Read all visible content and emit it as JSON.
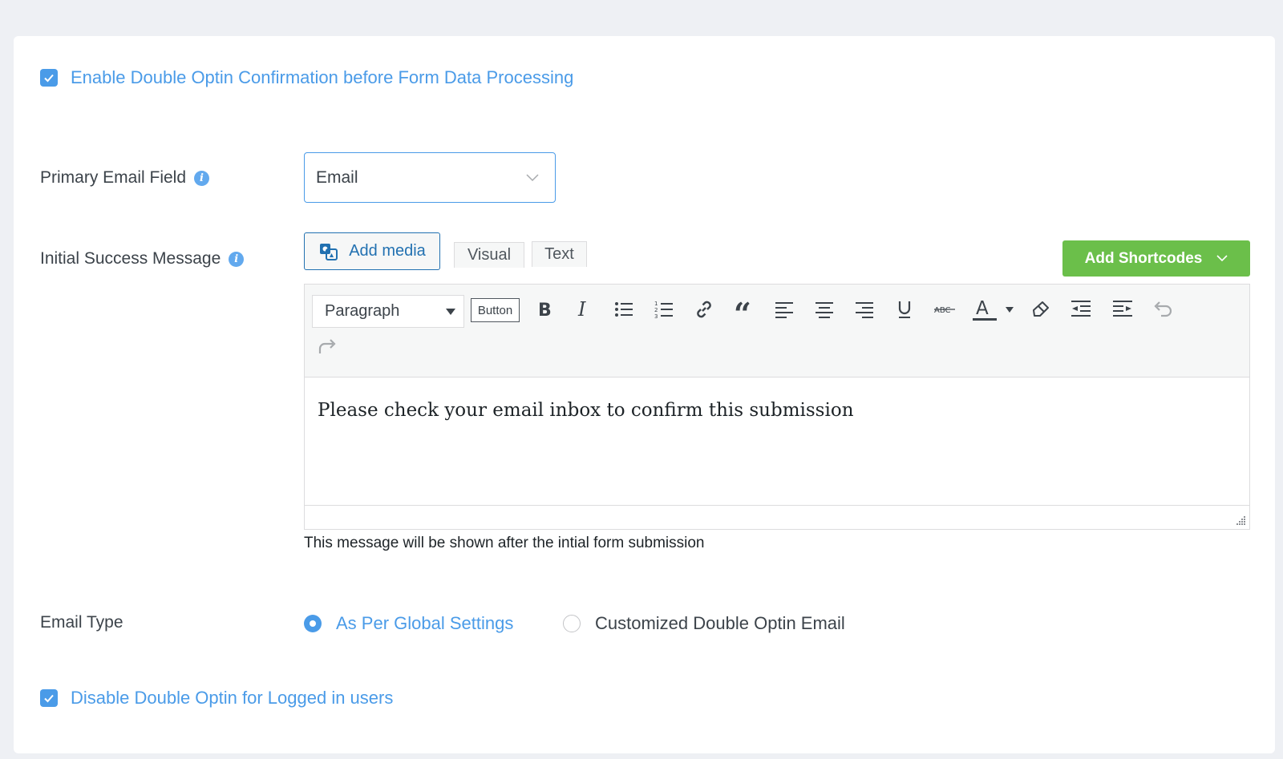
{
  "settings": {
    "enable_double_optin": {
      "label": "Enable Double Optin Confirmation before Form Data Processing",
      "checked": true
    },
    "primary_email_field": {
      "label": "Primary Email Field",
      "value": "Email"
    },
    "initial_success_message": {
      "label": "Initial Success Message",
      "add_media_label": "Add media",
      "tabs": {
        "visual": "Visual",
        "text": "Text"
      },
      "shortcodes_label": "Add Shortcodes",
      "format_select": "Paragraph",
      "button_label": "Button",
      "content": "Please check your email inbox to confirm this submission",
      "help_text": "This message will be shown after the intial form submission"
    },
    "email_type": {
      "label": "Email Type",
      "options": [
        {
          "label": "As Per Global Settings",
          "selected": true
        },
        {
          "label": "Customized Double Optin Email",
          "selected": false
        }
      ]
    },
    "disable_logged_in": {
      "label": "Disable Double Optin for Logged in users",
      "checked": true
    }
  },
  "toolbar_icons": [
    "bold-icon",
    "italic-icon",
    "bullet-list-icon",
    "numbered-list-icon",
    "link-icon",
    "blockquote-icon",
    "align-left-icon",
    "align-center-icon",
    "align-right-icon",
    "underline-icon",
    "strikethrough-icon",
    "text-color-icon",
    "clear-formatting-icon",
    "outdent-icon",
    "indent-icon",
    "undo-icon",
    "redo-icon"
  ],
  "colors": {
    "accent": "#4a9be8",
    "shortcodes_bg": "#6bbf4a",
    "wp_blue": "#2271b1"
  }
}
